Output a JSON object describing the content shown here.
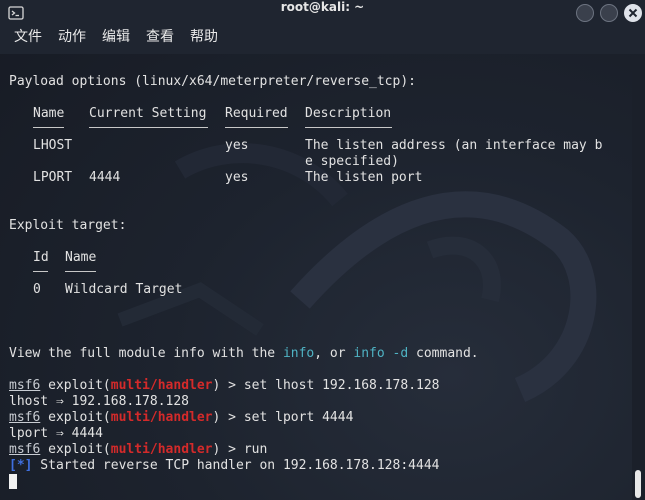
{
  "window": {
    "title": "root@kali: ~"
  },
  "menu": [
    "文件",
    "动作",
    "编辑",
    "查看",
    "帮助"
  ],
  "terminal": {
    "payload_header": "Payload options (linux/x64/meterpreter/reverse_tcp):",
    "payload_cols": {
      "name": "Name",
      "setting": "Current Setting",
      "required": "Required",
      "description": "Description"
    },
    "lhost_row": {
      "name": "LHOST",
      "setting": "",
      "required": "yes",
      "desc1": "The listen address (an interface may b",
      "desc2": "e specified)"
    },
    "lport_row": {
      "name": "LPORT",
      "setting": "4444",
      "required": "yes",
      "desc": "The listen port"
    },
    "exploit_header": "Exploit target:",
    "target_cols": {
      "id": "Id",
      "name": "Name"
    },
    "target_row": {
      "id": "0",
      "name": "Wildcard Target"
    },
    "info_line": {
      "pre": "View the full module info with the ",
      "cmd1": "info",
      "mid": ", or ",
      "cmd2": "info -d",
      "post": " command."
    },
    "prompt": {
      "prefix": "msf6",
      "mid": " exploit(",
      "module": "multi/handler",
      "suffix": ") > "
    },
    "cmd1": "set lhost 192.168.178.128",
    "out1": "lhost ⇒ 192.168.178.128",
    "cmd2": "set lport 4444",
    "out2": "lport ⇒ 4444",
    "cmd3": "run",
    "status": {
      "tag": "[*]",
      "text": " Started reverse TCP handler on 192.168.178.128:4444"
    }
  },
  "colors": {
    "module": "#d42a2a",
    "info_tag": "#3f6fdf",
    "highlight": "#4fb3c4",
    "background": "#1b202b"
  }
}
